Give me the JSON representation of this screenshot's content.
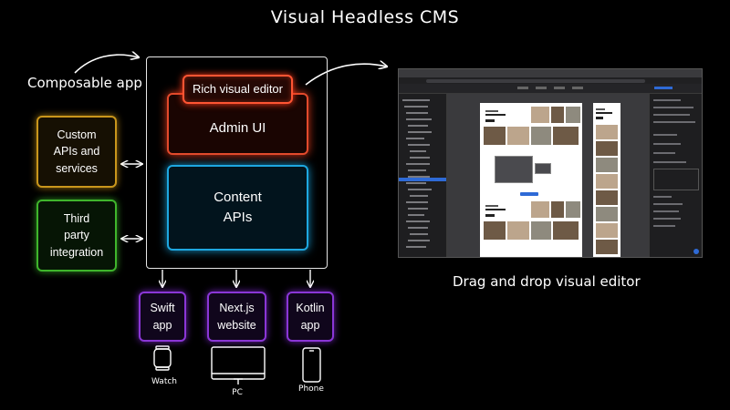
{
  "diagram": {
    "title": "Visual Headless CMS",
    "composable_label": "Composable app",
    "editor_caption": "Drag and drop visual editor"
  },
  "nodes": {
    "rich_visual_editor": "Rich visual editor",
    "admin_ui": "Admin UI",
    "content_apis": [
      "Content",
      "APIs"
    ],
    "custom_apis": [
      "Custom",
      "APIs and",
      "services"
    ],
    "third_party": [
      "Third",
      "party",
      "integration"
    ],
    "swift_app": [
      "Swift",
      "app"
    ],
    "nextjs_website": [
      "Next.js",
      "website"
    ],
    "kotlin_app": [
      "Kotlin",
      "app"
    ]
  },
  "devices": {
    "watch": "Watch",
    "pc": "PC",
    "phone": "Phone"
  },
  "colors": {
    "background": "#000000",
    "admin_ui": "#e24a2c",
    "rich_visual_editor": "#ff5533",
    "content_apis": "#1ea7e0",
    "custom_apis": "#c9961c",
    "third_party": "#3fb52c",
    "clients": "#8a36d6",
    "lines": "#ffffff"
  },
  "icons": [
    "watch-icon",
    "monitor-icon",
    "phone-icon"
  ]
}
